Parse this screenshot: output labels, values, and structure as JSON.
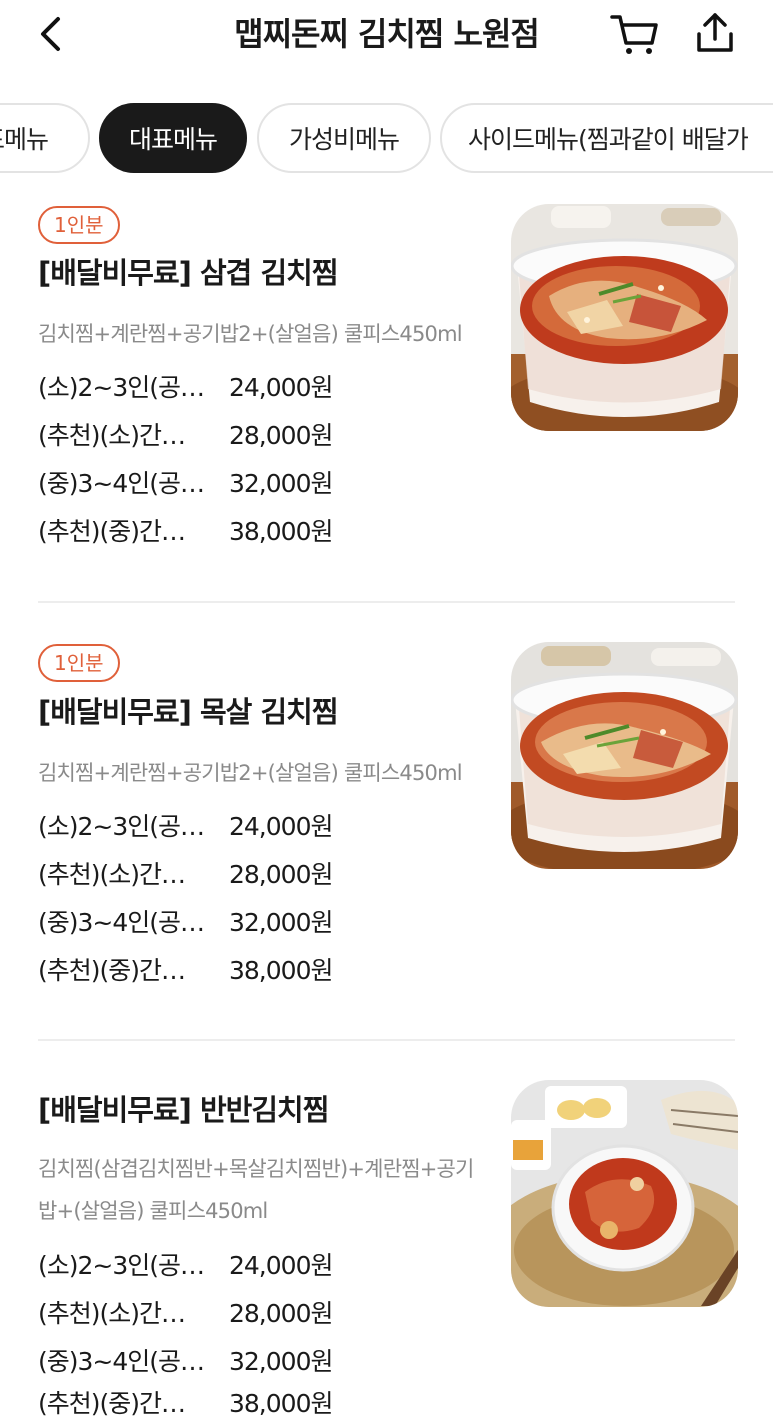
{
  "header": {
    "title": "맵찌돈찌 김치찜 노원점",
    "back_icon": "chevron-left-icon",
    "cart_icon": "cart-icon",
    "share_icon": "share-icon"
  },
  "tabs": [
    {
      "label": "표메뉴"
    },
    {
      "label": "대표메뉴",
      "active": true
    },
    {
      "label": "가성비메뉴"
    },
    {
      "label": "사이드메뉴(찜과같이 배달가"
    }
  ],
  "colors": {
    "accent": "#e0603a",
    "tab_active_bg": "#1a1a1a",
    "divider": "#ededed",
    "desc_text": "#8a8a8a"
  },
  "menu_items": [
    {
      "badge": "1인분",
      "name": "[배달비무료] 삼겹 김치찜",
      "desc": "김치찜+계란찜+공기밥2+(살얼음) 쿨피스450ml",
      "options": [
        {
          "name": "(소)2~3인(공…",
          "price": "24,000원"
        },
        {
          "name": "(추천)(소)간…",
          "price": "28,000원"
        },
        {
          "name": "(중)3~4인(공…",
          "price": "32,000원"
        },
        {
          "name": "(추천)(중)간…",
          "price": "38,000원"
        }
      ]
    },
    {
      "badge": "1인분",
      "name": "[배달비무료] 목살 김치찜",
      "desc": "김치찜+계란찜+공기밥2+(살얼음) 쿨피스450ml",
      "options": [
        {
          "name": "(소)2~3인(공…",
          "price": "24,000원"
        },
        {
          "name": "(추천)(소)간…",
          "price": "28,000원"
        },
        {
          "name": "(중)3~4인(공…",
          "price": "32,000원"
        },
        {
          "name": "(추천)(중)간…",
          "price": "38,000원"
        }
      ]
    },
    {
      "name": "[배달비무료] 반반김치찜",
      "desc": "김치찜(삼겹김치찜반+목살김치찜반)+계란찜+공기밥+(살얼음) 쿨피스450ml",
      "options": [
        {
          "name": "(소)2~3인(공…",
          "price": "24,000원"
        },
        {
          "name": "(추천)(소)간…",
          "price": "28,000원"
        },
        {
          "name": "(중)3~4인(공…",
          "price": "32,000원"
        },
        {
          "name": "(추천)(중)간…",
          "price": "38,000원"
        }
      ]
    }
  ]
}
